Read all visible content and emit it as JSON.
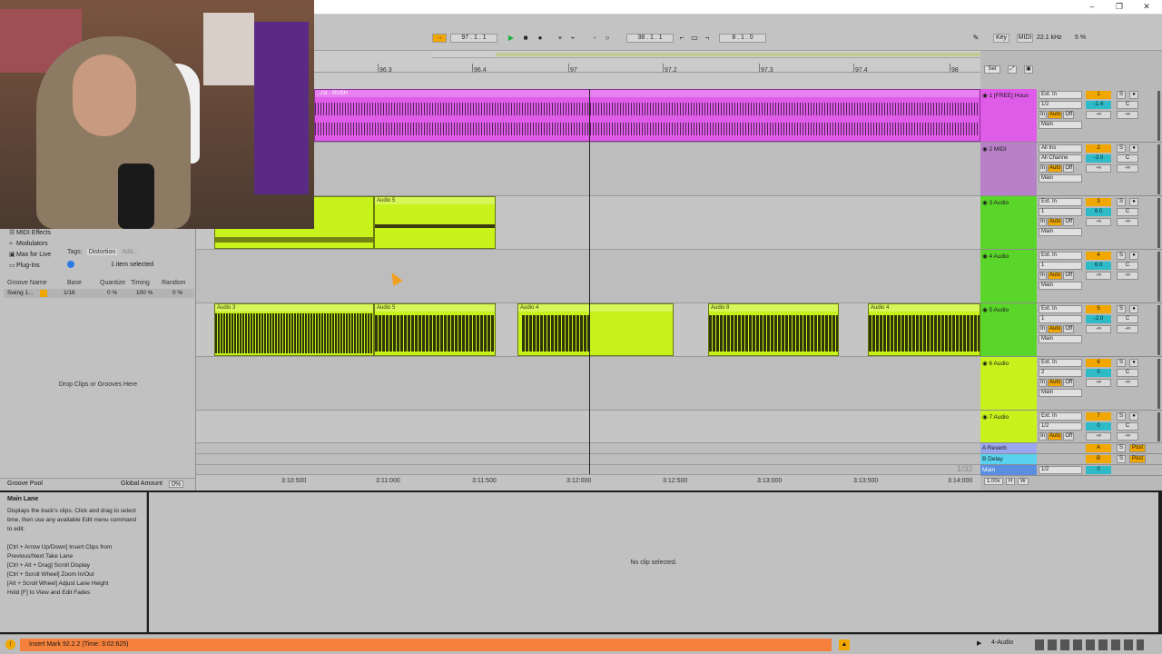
{
  "transport": {
    "tempo_pos": "97 .  1 .  1",
    "arrange_pos": "38 .  1 .  1",
    "loop_len": "8 .  1 .  0",
    "key_label": "Key",
    "midi_label": "MIDI",
    "sample_rate": "22.1 kHz",
    "cpu": "5 %"
  },
  "browser": {
    "categories": [
      "MIDI Effects",
      "Modulators",
      "Max for Live",
      "Plug-Ins"
    ],
    "tags_label": "Tags:",
    "tag_value": "Distortion",
    "tag_add": "Add...",
    "selected_info": "1 item selected",
    "groove_columns": [
      "Groove Name",
      "Base",
      "Quantize",
      "Timing",
      "Random"
    ],
    "groove_row": {
      "name": "Swing 1...",
      "base": "1/16",
      "quantize": "0 %",
      "timing": "100 %",
      "random": "0 %"
    },
    "drop_text": "Drop Clips or Grooves Here",
    "pool_label": "Groove Pool",
    "global_amount_label": "Global Amount",
    "global_amount_value": "0%"
  },
  "ruler": {
    "bars": [
      "96.3",
      "96.4",
      "97",
      "97.2",
      "97.3",
      "97.4",
      "98"
    ],
    "set_label": "Set"
  },
  "time_ruler": [
    "3:10:500",
    "3:11:000",
    "3:11:500",
    "3:12:000",
    "3:12:500",
    "3:13:000",
    "3:13:500",
    "3:14:000"
  ],
  "zoom_label": "1/32",
  "clips": {
    "track1": "...rst - RUSH",
    "track3_clip": "Audio 5",
    "track5": [
      "Audio 3",
      "Audio 5",
      "Audio 4",
      "Audio 8",
      "Audio 4"
    ]
  },
  "tracks": [
    {
      "name": "1 [FREE] Hous",
      "input": "Ext. In",
      "channel": "1/2",
      "mon": [
        "In",
        "Auto",
        "Off"
      ],
      "out": "Main",
      "num": "1",
      "vol": "-1.4",
      "pan": "C",
      "inf": "-∞"
    },
    {
      "name": "2 MIDI",
      "input": "All Ins",
      "channel": "All Channe",
      "mon": [
        "In",
        "Auto",
        "Off"
      ],
      "out": "Main",
      "num": "2",
      "vol": "-3.0",
      "pan": "C",
      "inf": "-∞"
    },
    {
      "name": "3 Audio",
      "input": "Ext. In",
      "channel": "1",
      "mon": [
        "In",
        "Auto",
        "Off"
      ],
      "out": "Main",
      "num": "3",
      "vol": "6.0",
      "pan": "C",
      "inf": "-∞"
    },
    {
      "name": "4 Audio",
      "input": "Ext. In",
      "channel": "1",
      "mon": [
        "In",
        "Auto",
        "Off"
      ],
      "out": "Main",
      "num": "4",
      "vol": "6.0",
      "pan": "C",
      "inf": "-∞"
    },
    {
      "name": "5 Audio",
      "input": "Ext. In",
      "channel": "1",
      "mon": [
        "In",
        "Auto",
        "Off"
      ],
      "out": "Main",
      "num": "5",
      "vol": "-2.0",
      "pan": "C",
      "inf": "-∞"
    },
    {
      "name": "6 Audio",
      "input": "Ext. In",
      "channel": "2",
      "mon": [
        "In",
        "Auto",
        "Off"
      ],
      "out": "Main",
      "num": "6",
      "vol": "0",
      "pan": "C",
      "inf": "-∞"
    },
    {
      "name": "7 Audio",
      "input": "Ext. In",
      "channel": "1/2",
      "mon": [
        "In",
        "Auto",
        "Off"
      ],
      "out": "Main",
      "num": "7",
      "vol": "0",
      "pan": "C",
      "inf": "-∞"
    }
  ],
  "returns": [
    {
      "name": "A Reverb",
      "num": "A",
      "post": "Post"
    },
    {
      "name": "B Delay",
      "num": "B",
      "post": "Post"
    }
  ],
  "main": {
    "name": "Main",
    "channel": "1/2",
    "vol": "0"
  },
  "track_footer": [
    "1.00x",
    "H",
    "W"
  ],
  "info": {
    "title": "Main Lane",
    "body": "Displays the track's clips. Click and drag to select time, then use any available Edit menu command to edit.\n\n[Ctrl + Arrow Up/Down] Insert Clips from Previous/Next Take Lane\n[Ctrl + Alt + Drag] Scroll Display\n[Ctrl + Scroll Wheel] Zoom In/Out\n[Alt + Scroll Wheel] Adjust Lane Height\nHold [F] to View and Edit Fades"
  },
  "detail": {
    "empty": "No clip selected."
  },
  "status": {
    "message": "Insert Mark 92.2.2 (Time: 3:02:625)",
    "track": "4-Audio"
  },
  "colors": {
    "magenta": "#de5ce8",
    "lime": "#c7f21c",
    "green": "#5ad52a",
    "orange": "#f1a700",
    "cyan": "#2fbac8",
    "status": "#f5813c"
  }
}
